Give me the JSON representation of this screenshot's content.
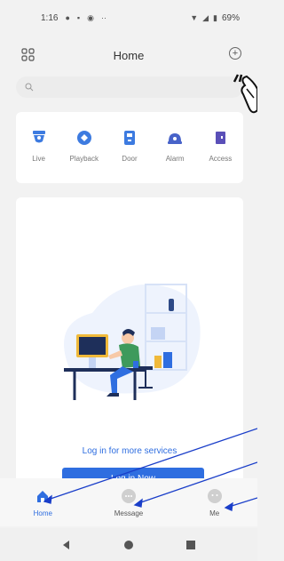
{
  "status_bar": {
    "time": "1:16",
    "battery": "69%"
  },
  "header": {
    "title": "Home"
  },
  "search": {
    "placeholder": ""
  },
  "quick_actions": [
    {
      "label": "Live",
      "icon": "camera-icon",
      "color": "#3d7be0"
    },
    {
      "label": "Playback",
      "icon": "playback-icon",
      "color": "#3d7be0"
    },
    {
      "label": "Door",
      "icon": "door-icon",
      "color": "#3d7be0"
    },
    {
      "label": "Alarm",
      "icon": "alarm-icon",
      "color": "#4863c9"
    },
    {
      "label": "Access",
      "icon": "access-icon",
      "color": "#5a4fb8"
    }
  ],
  "main": {
    "login_prompt": "Log in for more services",
    "login_button": "Log in Now"
  },
  "tabs": [
    {
      "label": "Home",
      "icon": "home-icon",
      "active": true
    },
    {
      "label": "Message",
      "icon": "message-icon",
      "active": false
    },
    {
      "label": "Me",
      "icon": "me-icon",
      "active": false
    }
  ],
  "colors": {
    "accent": "#2f6ee0",
    "background": "#f2f2f2",
    "card": "#ffffff"
  }
}
